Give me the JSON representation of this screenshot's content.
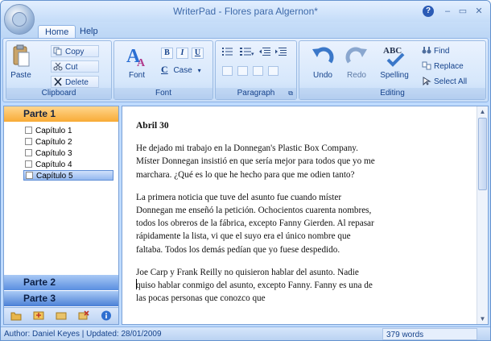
{
  "window": {
    "title": "WriterPad - Flores para Algernon*"
  },
  "tabs": [
    {
      "label": "Home"
    },
    {
      "label": "Help"
    }
  ],
  "ribbon": {
    "clipboard": {
      "label": "Clipboard",
      "paste": "Paste",
      "copy": "Copy",
      "cut": "Cut",
      "delete": "Delete"
    },
    "font": {
      "label": "Font",
      "font_button": "Font",
      "bold": "B",
      "italic": "I",
      "underline": "U",
      "case": "Case",
      "case_glyph": "C"
    },
    "paragraph": {
      "label": "Paragraph"
    },
    "editing": {
      "label": "Editing",
      "undo": "Undo",
      "redo": "Redo",
      "spelling": "Spelling",
      "find": "Find",
      "replace": "Replace",
      "select_all": "Select All"
    }
  },
  "sidebar": {
    "parts": [
      {
        "label": "Parte 1"
      },
      {
        "label": "Parte 2"
      },
      {
        "label": "Parte 3"
      }
    ],
    "chapters": [
      {
        "label": "Capítulo 1"
      },
      {
        "label": "Capítulo 2"
      },
      {
        "label": "Capítulo 3"
      },
      {
        "label": "Capítulo 4"
      },
      {
        "label": "Capítulo 5"
      }
    ],
    "selected_chapter": "Capítulo 5"
  },
  "document": {
    "heading": "Abril 30",
    "paragraphs": [
      "He dejado mi trabajo en la Donnegan's Plastic Box Company. Míster Donnegan insistió en que sería mejor para todos que yo me marchara. ¿Qué es lo que he hecho para que me odien tanto?",
      "La primera noticia que tuve del asunto fue cuando míster Donnegan me enseñó la petición. Ochocientos cuarenta nombres, todos los obreros de la fábrica, excepto Fanny Gierden. Al repasar rápidamente la lista, vi que el suyo era el único nombre que faltaba. Todos los demás pedían que yo fuese despedido.",
      "Joe Carp y Frank Reilly no quisieron hablar del asunto. Nadie quiso hablar conmigo del asunto, excepto Fanny. Fanny es una de las pocas personas que conozco que"
    ]
  },
  "status": {
    "left": "Author: Daniel Keyes | Updated: 28/01/2009",
    "words": "379 words"
  },
  "colors": {
    "ribbon": "#dbe8fb",
    "part_active": "#f8ab36",
    "part_inactive": "#5a8ee0",
    "accent": "#15428b"
  }
}
